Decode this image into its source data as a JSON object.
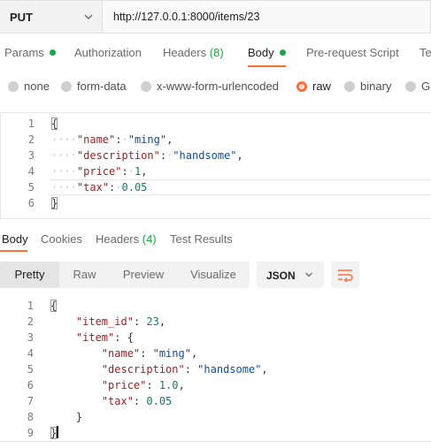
{
  "request": {
    "method": "PUT",
    "url": "http://127.0.0.1:8000/items/23"
  },
  "request_tabs": [
    {
      "label": "Params",
      "dot": true
    },
    {
      "label": "Authorization"
    },
    {
      "label": "Headers",
      "count": "(8)"
    },
    {
      "label": "Body",
      "dot": true,
      "active": true
    },
    {
      "label": "Pre-request Script"
    },
    {
      "label": "Te"
    }
  ],
  "body_types": [
    {
      "label": "none",
      "selected": false
    },
    {
      "label": "form-data",
      "selected": false
    },
    {
      "label": "x-www-form-urlencoded",
      "selected": false
    },
    {
      "label": "raw",
      "selected": true
    },
    {
      "label": "binary",
      "selected": false
    },
    {
      "label": "Gr",
      "selected": false
    }
  ],
  "request_body_lines": [
    {
      "n": "1",
      "text": "{"
    },
    {
      "n": "2",
      "key": "\"name\"",
      "value": "\"ming\"",
      "type": "str",
      "trail": ","
    },
    {
      "n": "3",
      "key": "\"description\"",
      "value": "\"handsome\"",
      "type": "str",
      "trail": ","
    },
    {
      "n": "4",
      "key": "\"price\"",
      "value": "1",
      "type": "num",
      "trail": ","
    },
    {
      "n": "5",
      "key": "\"tax\"",
      "value": "0.05",
      "type": "num",
      "trail": ""
    },
    {
      "n": "6",
      "text": "}"
    }
  ],
  "response_tabs": [
    {
      "label": "Body",
      "active": true
    },
    {
      "label": "Cookies"
    },
    {
      "label": "Headers",
      "count": "(4)"
    },
    {
      "label": "Test Results"
    }
  ],
  "view_modes": [
    "Pretty",
    "Raw",
    "Preview",
    "Visualize"
  ],
  "active_view": "Pretty",
  "format": "JSON",
  "response_lines": [
    {
      "n": "1",
      "text": "{"
    },
    {
      "n": "2",
      "key": "\"item_id\"",
      "value": "23",
      "type": "num",
      "trail": ",",
      "indent": 1
    },
    {
      "n": "3",
      "key": "\"item\"",
      "value": "{",
      "type": "pun",
      "trail": "",
      "indent": 1
    },
    {
      "n": "4",
      "key": "\"name\"",
      "value": "\"ming\"",
      "type": "str",
      "trail": ",",
      "indent": 2
    },
    {
      "n": "5",
      "key": "\"description\"",
      "value": "\"handsome\"",
      "type": "str",
      "trail": ",",
      "indent": 2
    },
    {
      "n": "6",
      "key": "\"price\"",
      "value": "1.0",
      "type": "num",
      "trail": ",",
      "indent": 2
    },
    {
      "n": "7",
      "key": "\"tax\"",
      "value": "0.05",
      "type": "num",
      "trail": "",
      "indent": 2
    },
    {
      "n": "8",
      "text": "}",
      "indent": 1
    },
    {
      "n": "9",
      "text": "}"
    }
  ],
  "colors": {
    "accent": "#ff6c37",
    "dot_green": "#1ea446",
    "json_key": "#a11f1f",
    "json_string": "#0a4fa8",
    "json_number": "#0f7c6c"
  },
  "icons": {
    "method_dropdown": "chevron-down-icon",
    "format_dropdown": "chevron-down-icon",
    "wrap": "wrap-lines-icon"
  }
}
